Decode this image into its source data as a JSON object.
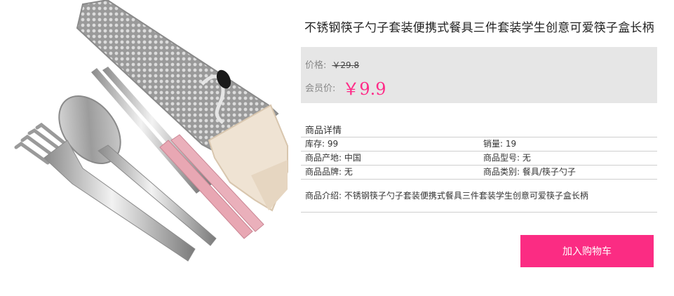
{
  "product": {
    "title": "不锈钢筷子勺子套装便携式餐具三件套装学生创意可爱筷子盒长柄",
    "image_alt": "product-photo-cutlery-set"
  },
  "price": {
    "original_label": "价格:",
    "original_value": "￥29.8",
    "member_label": "会员价:",
    "member_value": "￥9.9"
  },
  "details": {
    "title": "商品详情",
    "rows": [
      [
        {
          "text": "库存: 99"
        },
        {
          "text": "销量: 19"
        }
      ],
      [
        {
          "text": "商品产地: 中国"
        },
        {
          "text": "商品型号: 无"
        }
      ],
      [
        {
          "text": "商品品牌: 无"
        },
        {
          "text": "商品类别: 餐具/筷子勺子"
        }
      ]
    ],
    "intro": "商品介绍: 不锈钢筷子勺子套装便携式餐具三件套装学生创意可爱筷子盒长柄"
  },
  "actions": {
    "add_to_cart": "加入购物车"
  },
  "colors": {
    "accent": "#fb2c83",
    "price_bg": "#e6e6e6",
    "member_price": "#ff2b88"
  }
}
